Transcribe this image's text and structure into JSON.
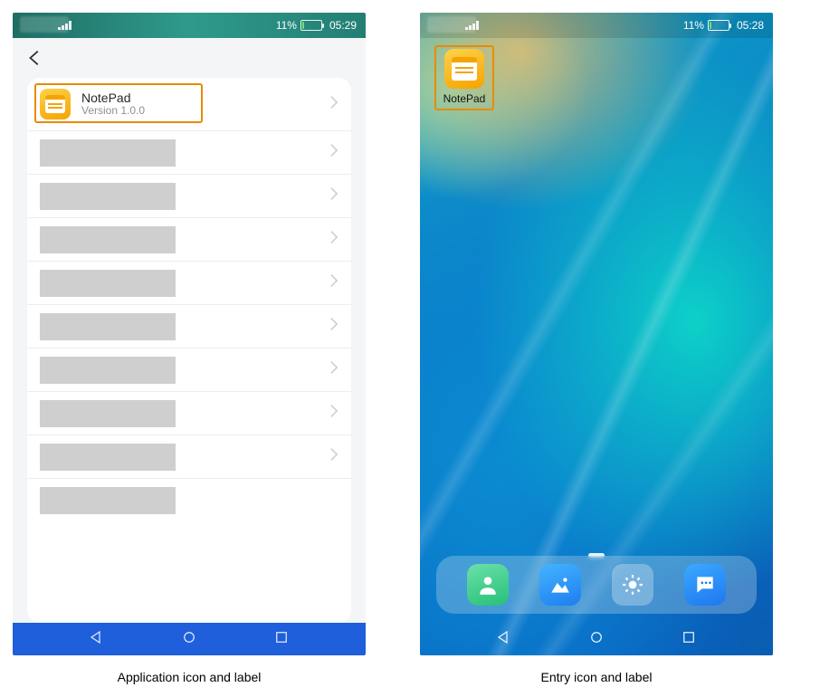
{
  "left": {
    "status": {
      "battery_text": "11%",
      "time": "05:29"
    },
    "app": {
      "name": "NotePad",
      "version": "Version 1.0.0",
      "icon": "notepad-icon"
    },
    "placeholder_rows": 8,
    "caption": "Application icon and label"
  },
  "right": {
    "status": {
      "battery_text": "11%",
      "time": "05:28"
    },
    "home_app": {
      "label": "NotePad",
      "icon": "notepad-icon"
    },
    "dock": [
      {
        "name": "contacts-icon"
      },
      {
        "name": "gallery-icon"
      },
      {
        "name": "settings-icon"
      },
      {
        "name": "messages-icon"
      }
    ],
    "caption": "Entry icon and label"
  },
  "colors": {
    "highlight_box": "#e88b00",
    "nav_blue": "#1f5fdc"
  }
}
